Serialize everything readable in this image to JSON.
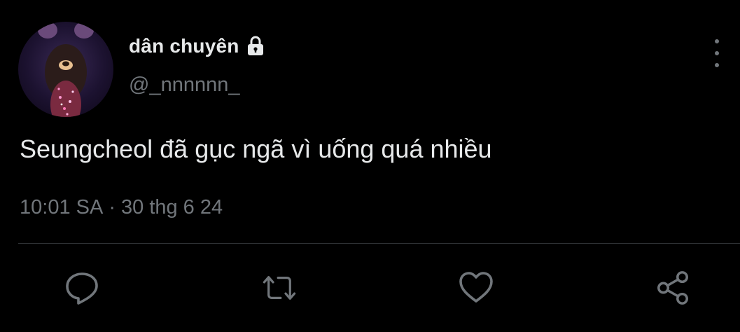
{
  "author": {
    "display_name": "dân chuyên",
    "handle": "@_nnnnnn_",
    "protected_icon": "lock-icon",
    "avatar_icon": "avatar-photo"
  },
  "tweet": {
    "text": "Seungcheol đã gục ngã vì uống quá nhiều",
    "time": "10:01 SA",
    "separator": "·",
    "date": "30 thg 6 24"
  },
  "actions": {
    "reply_icon": "reply-icon",
    "retweet_icon": "retweet-icon",
    "like_icon": "heart-icon",
    "share_icon": "share-icon",
    "more_icon": "more-vertical-icon"
  },
  "colors": {
    "background": "#000000",
    "primary_text": "#e7e9ea",
    "secondary_text": "#71767b",
    "divider": "#2f3336"
  }
}
